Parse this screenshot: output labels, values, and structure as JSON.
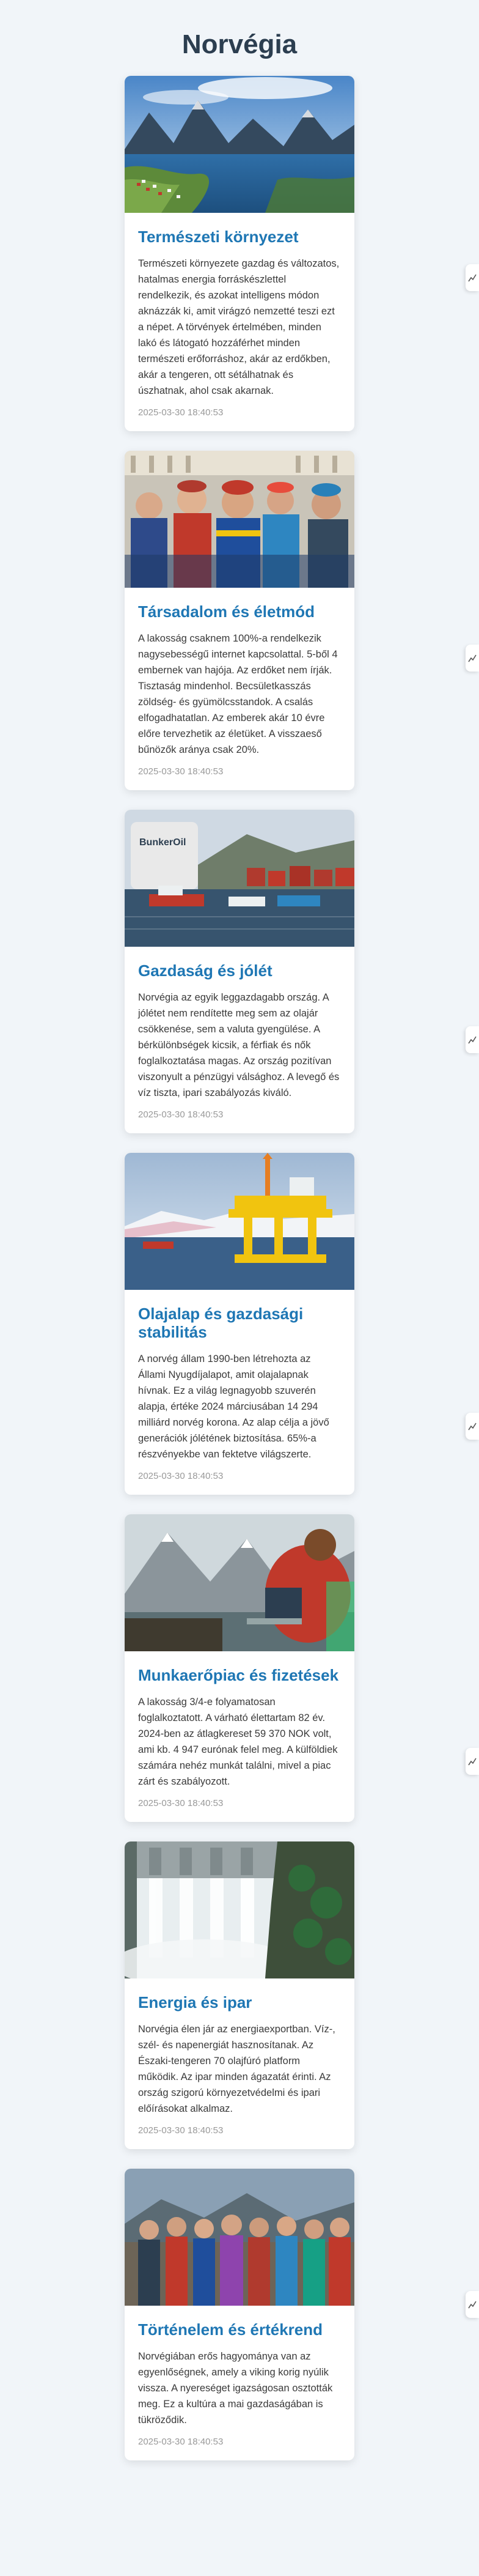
{
  "page": {
    "title": "Norvégia"
  },
  "cards": [
    {
      "title": "Természeti környezet",
      "text": "Természeti környezete gazdag és változatos, hatalmas energia forráskészlettel rendelkezik, és azokat intelligens módon aknázzák ki, amit virágzó nemzetté teszi ezt a népet. A törvények értelmében, minden lakó és látogató hozzáférhet minden természeti erőforráshoz, akár az erdőkben, akár a tengeren, ott sétálhatnak és úszhatnak, ahol csak akarnak.",
      "date": "2025-03-30 18:40:53",
      "image_icon": "fjord-landscape-photo"
    },
    {
      "title": "Társadalom és életmód",
      "text": "A lakosság csaknem 100%-a rendelkezik nagysebességű internet kapcsolattal. 5-ből 4 embernek van hajója. Az erdőket nem írják. Tisztaság mindenhol. Becsületkasszás zöldség- és gyümölcsstandok. A csalás elfogadhatatlan. Az emberek akár 10 évre előre tervezhetik az életüket. A visszaeső bűnözők aránya csak 20%.",
      "date": "2025-03-30 18:40:53",
      "image_icon": "crowd-in-traditional-clothing-photo"
    },
    {
      "title": "Gazdaság és jólét",
      "text": "Norvégia az egyik leggazdagabb ország. A jólétet nem rendítette meg sem az olajár csökkenése, sem a valuta gyengülése. A bérkülönbségek kicsik, a férfiak és nők foglalkoztatása magas. Az ország pozitívan viszonyult a pénzügyi válsághoz. A levegő és víz tiszta, ipari szabályozás kiváló.",
      "date": "2025-03-30 18:40:53",
      "image_icon": "harbor-with-boats-photo"
    },
    {
      "title": "Olajalap és gazdasági stabilitás",
      "text": "A norvég állam 1990-ben létrehozta az Állami Nyugdíjalapot, amit olajalapnak hívnak. Ez a világ legnagyobb szuverén alapja, értéke 2024 márciusában 14 294 milliárd norvég korona. Az alap célja a jövő generációk jólétének biztosítása. 65%-a részvényekbe van fektetve világszerte.",
      "date": "2025-03-30 18:40:53",
      "image_icon": "oil-platform-photo"
    },
    {
      "title": "Munkaerőpiac és fizetések",
      "text": "A lakosság 3/4-e folyamatosan foglalkoztatott. A várható élettartam 82 év. 2024-ben az átlagkereset 59 370 NOK volt, ami kb. 4 947 eurónak felel meg. A külföldiek számára nehéz munkát találni, mivel a piac zárt és szabályozott.",
      "date": "2025-03-30 18:40:53",
      "image_icon": "person-with-laptop-photo"
    },
    {
      "title": "Energia és ipar",
      "text": "Norvégia élen jár az energiaexportban. Víz-, szél- és napenergiát hasznosítanak. Az Északi-tengeren 70 olajfúró platform működik. Az ipar minden ágazatát érinti. Az ország szigorú környezetvédelmi és ipari előírásokat alkalmaz.",
      "date": "2025-03-30 18:40:53",
      "image_icon": "hydro-dam-waterfall-photo"
    },
    {
      "title": "Történelem és értékrend",
      "text": "Norvégiában erős hagyománya van az egyenlőségnek, amely a viking korig nyúlik vissza. A nyereséget igazságosan osztották meg. Ez a kultúra a mai gazdaságában is tükröződik.",
      "date": "2025-03-30 18:40:53",
      "image_icon": "people-in-folk-costume-photo"
    }
  ],
  "side_tabs": [
    {
      "icon": "chart-icon"
    },
    {
      "icon": "chart-icon"
    },
    {
      "icon": "chart-icon"
    },
    {
      "icon": "chart-icon"
    },
    {
      "icon": "chart-icon"
    },
    {
      "icon": "chart-icon"
    }
  ],
  "colors": {
    "background": "#f1f5f9",
    "title": "#2c3e50",
    "card_title": "#1f77b4",
    "date": "#999999"
  }
}
